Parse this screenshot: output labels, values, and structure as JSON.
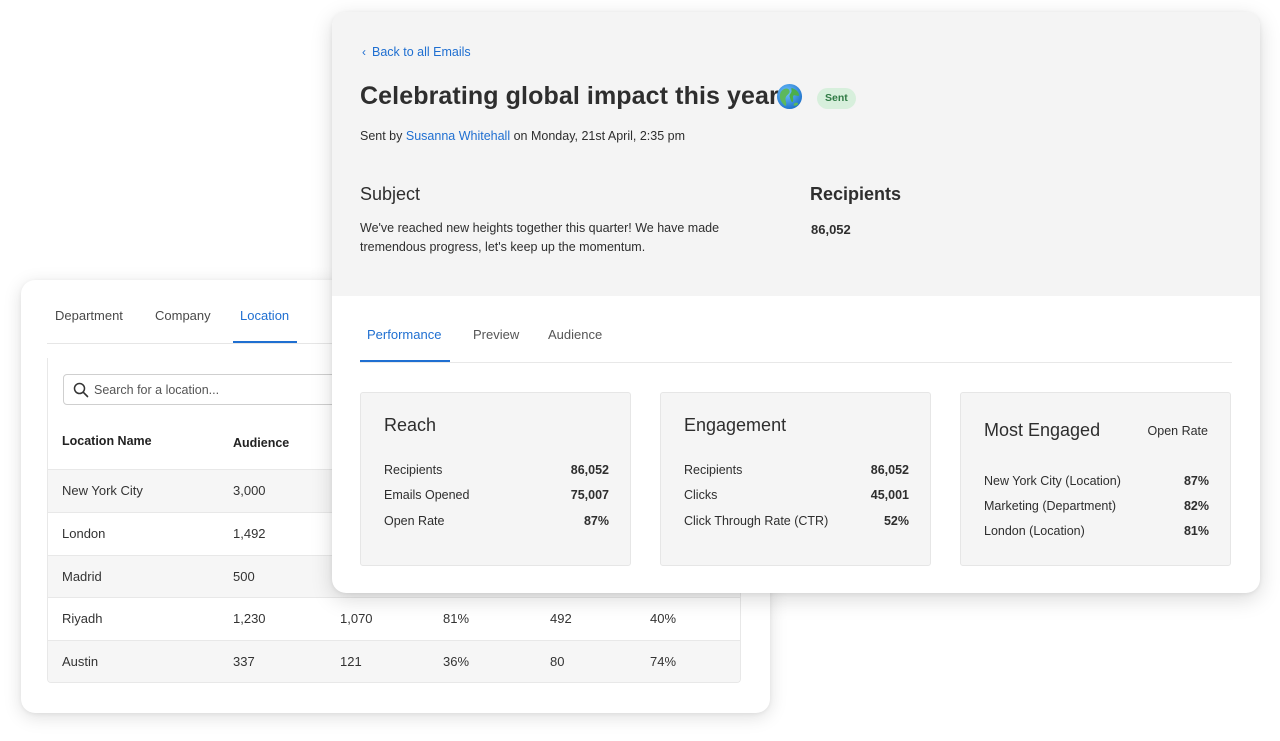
{
  "locations_panel": {
    "tabs": [
      "Department",
      "Company",
      "Location"
    ],
    "active_tab": "Location",
    "search": {
      "placeholder": "Search for a location..."
    },
    "columns": [
      "Location Name",
      "Audience"
    ],
    "rows": [
      [
        "New York City",
        "3,000",
        "",
        "",
        "",
        ""
      ],
      [
        "London",
        "1,492",
        "",
        "",
        "",
        ""
      ],
      [
        "Madrid",
        "500",
        "",
        "",
        "",
        ""
      ],
      [
        "Riyadh",
        "1,230",
        "1,070",
        "81%",
        "492",
        "40%"
      ],
      [
        "Austin",
        "337",
        "121",
        "36%",
        "80",
        "74%"
      ]
    ]
  },
  "email": {
    "back_link": "Back to all Emails",
    "title": "Celebrating global impact this year",
    "title_icon": "globe-emoji-icon",
    "status": "Sent",
    "sent_by_prefix": "Sent by",
    "author": "Susanna Whitehall",
    "sent_on": "on Monday, 21st April, 2:35 pm",
    "subject_heading": "Subject",
    "subject_text": "We've reached new heights together this quarter! We have made tremendous progress, let's keep up the momentum.",
    "recipients_heading": "Recipients",
    "recipients_value": "86,052",
    "tabs": [
      "Performance",
      "Preview",
      "Audience"
    ],
    "active_tab": "Performance"
  },
  "metrics": {
    "reach": {
      "title": "Reach",
      "rows": [
        {
          "label": "Recipients",
          "value": "86,052"
        },
        {
          "label": "Emails Opened",
          "value": "75,007"
        },
        {
          "label": "Open Rate",
          "value": "87%"
        }
      ]
    },
    "engagement": {
      "title": "Engagement",
      "rows": [
        {
          "label": "Recipients",
          "value": "86,052"
        },
        {
          "label": "Clicks",
          "value": "45,001"
        },
        {
          "label": "Click Through Rate (CTR)",
          "value": "52%"
        }
      ]
    },
    "most_engaged": {
      "title": "Most Engaged",
      "subhead": "Open Rate",
      "rows": [
        {
          "label": "New York City (Location)",
          "value": "87%"
        },
        {
          "label": "Marketing (Department)",
          "value": "82%"
        },
        {
          "label": "London (Location)",
          "value": "81%"
        }
      ]
    }
  },
  "colors": {
    "accent": "#1f6fd1",
    "badge_bg": "#d7efdc",
    "badge_text": "#2f7a44",
    "header_bg": "#f4f4f4"
  }
}
